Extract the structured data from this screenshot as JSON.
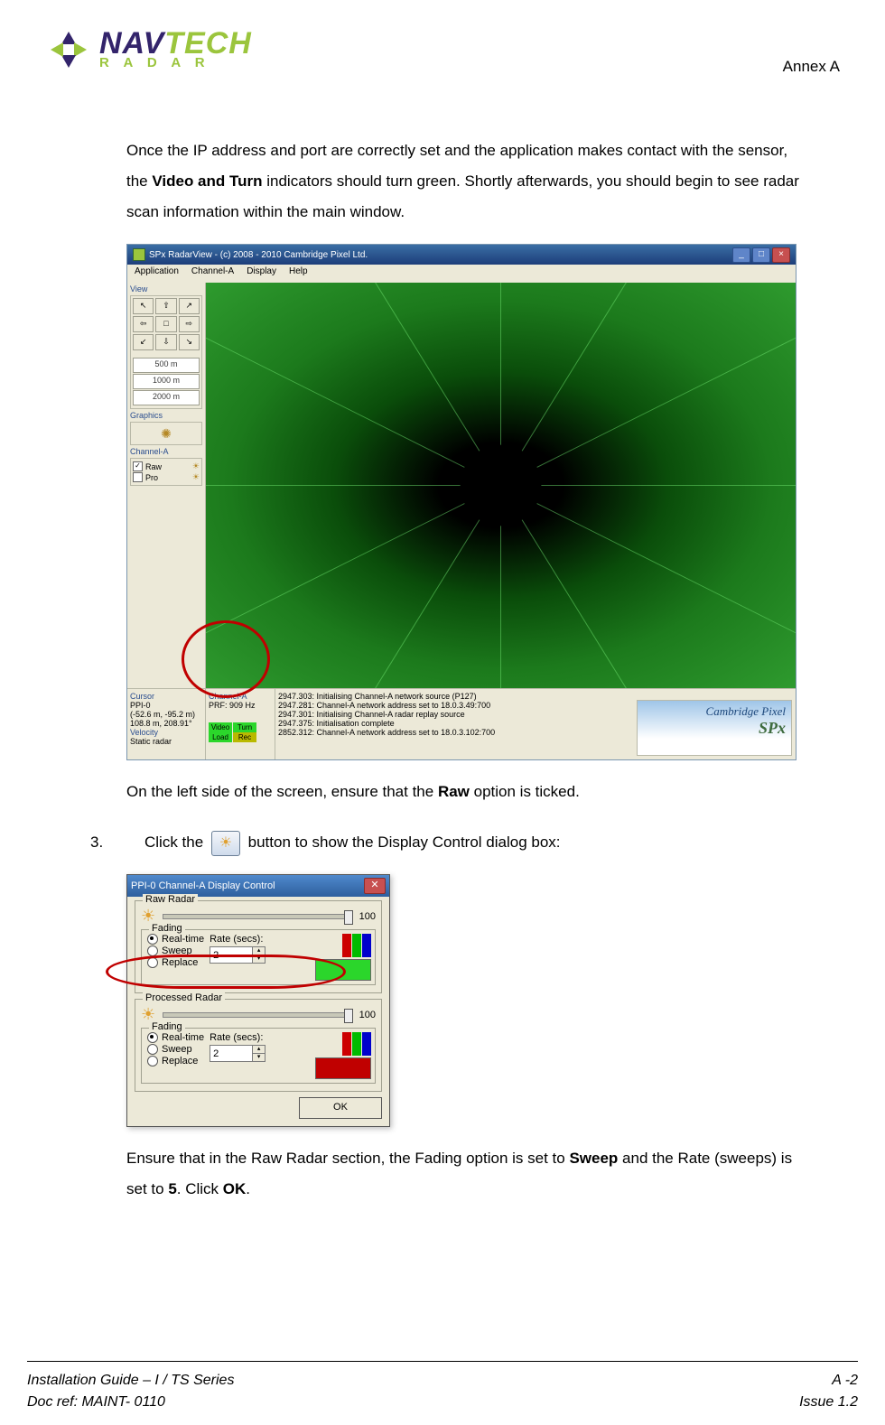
{
  "header": {
    "logo_nav": "NAV",
    "logo_tech": "TECH",
    "logo_sub": "R  A  D  A  R",
    "annex": "Annex A"
  },
  "para1_a": "Once the IP address and port are correctly set and the application makes contact with the sensor, the ",
  "para1_bold": "Video and Turn",
  "para1_b": " indicators should turn green. Shortly afterwards, you should begin to see radar scan information within the main window.",
  "radarview": {
    "title": "SPx RadarView - (c) 2008 - 2010 Cambridge Pixel Ltd.",
    "menus": {
      "app": "Application",
      "ch": "Channel-A",
      "disp": "Display",
      "help": "Help"
    },
    "view_label": "View",
    "ranges": {
      "r1": "500 m",
      "r2": "1000 m",
      "r3": "2000 m"
    },
    "graphics_label": "Graphics",
    "channel_label": "Channel-A",
    "raw": "Raw",
    "pro": "Pro",
    "cursor_label": "Cursor",
    "ppi": "PPI-0",
    "cursor_pos": "(-52.6 m, -95.2 m)",
    "cursor_rng": "108.8 m, 208.91°",
    "velocity_label": "Velocity",
    "velocity_val": "Static radar",
    "chA_label": "Channel-A",
    "prf": "PRF: 909 Hz",
    "ind_video": "Video",
    "ind_turn": "Turn",
    "ind_load": "Load",
    "ind_rec": "Rec",
    "log1": "2947.303: Initialising Channel-A network source (P127)",
    "log2": "2947.281: Channel-A network address set to 18.0.3.49:700",
    "log3": "2947.301: Initialising Channel-A radar replay source",
    "log4": "2947.375: Initialisation complete",
    "log5": "2852.312: Channel-A network address set to 18.0.3.102:700",
    "brand_top": "Cambridge Pixel",
    "brand_bot": "SPx"
  },
  "para2_a": "On the left side of the screen, ensure that the ",
  "para2_bold": "Raw",
  "para2_b": " option is ticked.",
  "step3": {
    "num": "3.",
    "a": "Click the ",
    "b": " button to show the Display Control dialog box:"
  },
  "dialog": {
    "title": "PPI-0 Channel-A Display Control",
    "raw_legend": "Raw Radar",
    "proc_legend": "Processed Radar",
    "brightness": "100",
    "fading_legend": "Fading",
    "opt_rt": "Real-time",
    "opt_sweep": "Sweep",
    "opt_replace": "Replace",
    "rate_label": "Rate (secs):",
    "rate_val": "2",
    "ok": "OK"
  },
  "para3_a": "Ensure that in the Raw Radar section, the Fading option is set to ",
  "para3_b1": "Sweep",
  "para3_c": " and the Rate (sweeps) is set to ",
  "para3_b2": "5",
  "para3_d": ". Click ",
  "para3_b3": "OK",
  "para3_e": ".",
  "footer": {
    "left1": "Installation Guide – I / TS Series",
    "right1": "A -2",
    "left2": "Doc ref: MAINT- 0110",
    "right2": "Issue 1.2"
  }
}
